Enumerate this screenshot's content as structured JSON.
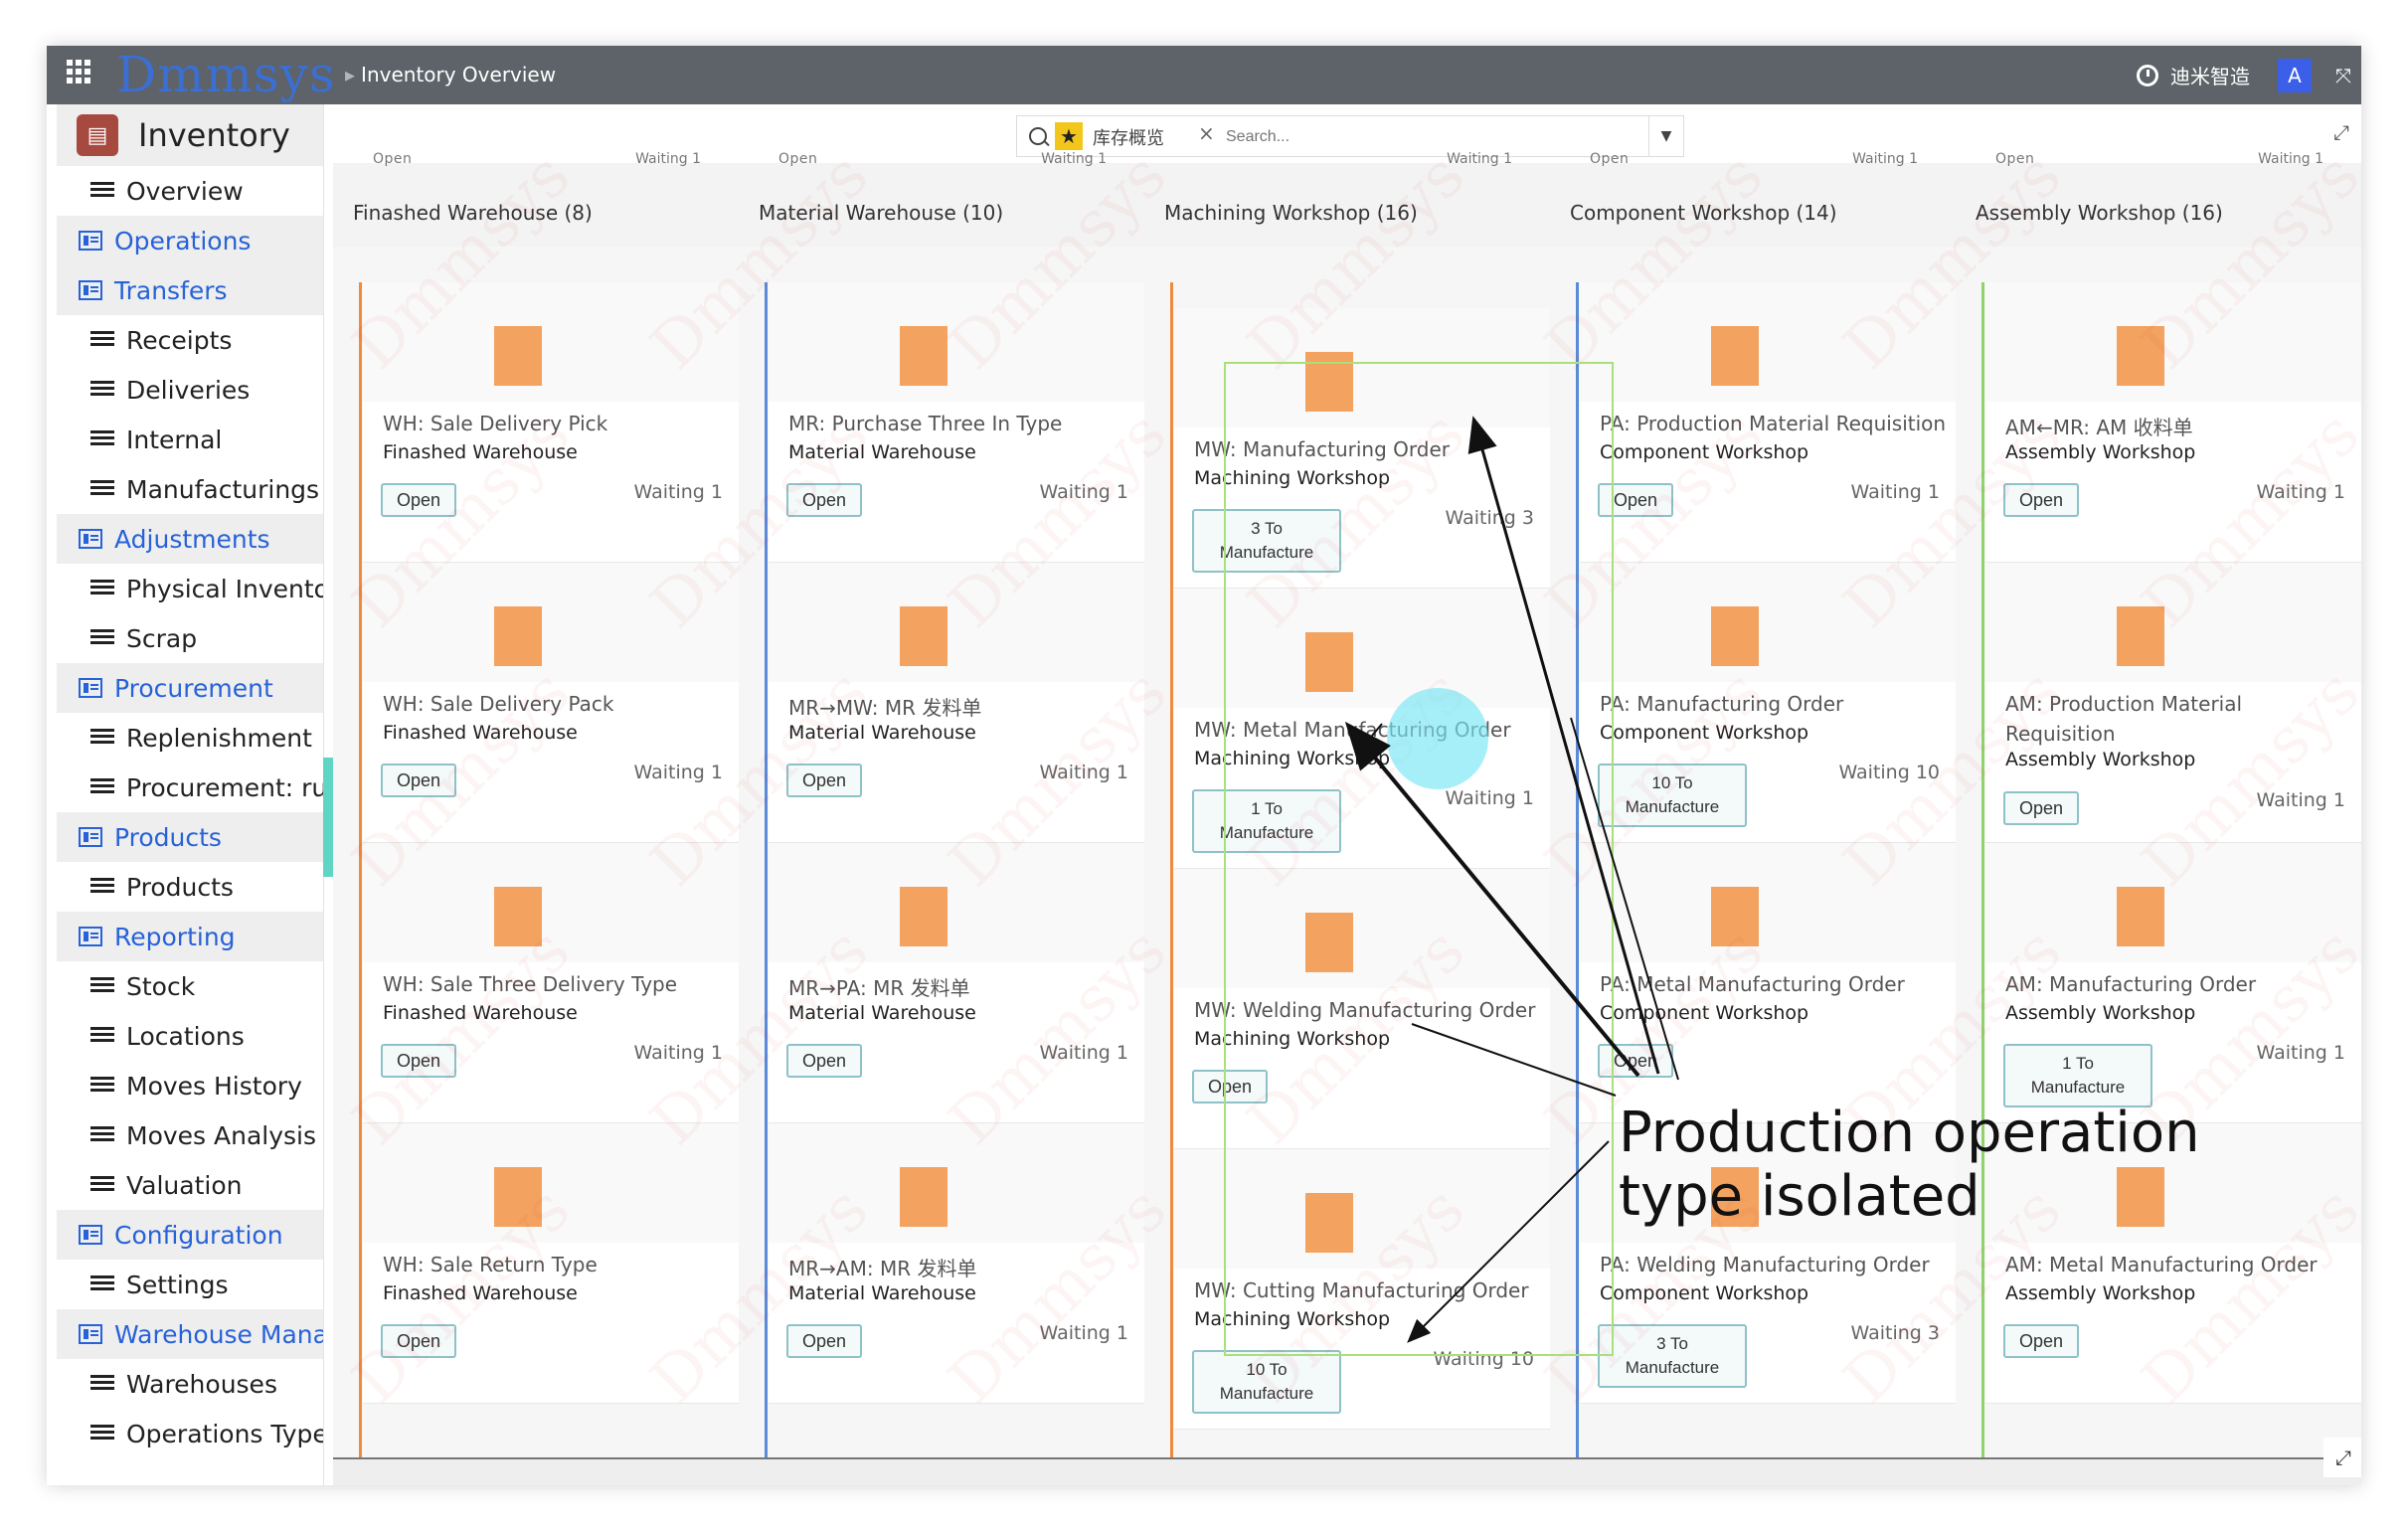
{
  "app": {
    "logo": "Dmmsys",
    "breadcrumb": "Inventory Overview",
    "company": "迪米智造",
    "avatar": "A"
  },
  "sidebar": {
    "app_name": "Inventory",
    "items": [
      {
        "label": "Overview",
        "type": "leaf"
      },
      {
        "label": "Operations",
        "type": "section"
      },
      {
        "label": "Transfers",
        "type": "section"
      },
      {
        "label": "Receipts",
        "type": "leaf"
      },
      {
        "label": "Deliveries",
        "type": "leaf"
      },
      {
        "label": "Internal",
        "type": "leaf"
      },
      {
        "label": "Manufacturings",
        "type": "leaf"
      },
      {
        "label": "Adjustments",
        "type": "section"
      },
      {
        "label": "Physical Inventory",
        "type": "leaf"
      },
      {
        "label": "Scrap",
        "type": "leaf"
      },
      {
        "label": "Procurement",
        "type": "section"
      },
      {
        "label": "Replenishment",
        "type": "leaf"
      },
      {
        "label": "Procurement: run",
        "type": "leaf"
      },
      {
        "label": "Products",
        "type": "section"
      },
      {
        "label": "Products",
        "type": "leaf"
      },
      {
        "label": "Reporting",
        "type": "section"
      },
      {
        "label": "Stock",
        "type": "leaf"
      },
      {
        "label": "Locations",
        "type": "leaf"
      },
      {
        "label": "Moves History",
        "type": "leaf"
      },
      {
        "label": "Moves Analysis",
        "type": "leaf"
      },
      {
        "label": "Valuation",
        "type": "leaf"
      },
      {
        "label": "Configuration",
        "type": "section"
      },
      {
        "label": "Settings",
        "type": "leaf"
      },
      {
        "label": "Warehouse Manag",
        "type": "section"
      },
      {
        "label": "Warehouses",
        "type": "leaf"
      },
      {
        "label": "Operations Types",
        "type": "leaf"
      }
    ]
  },
  "search": {
    "facet": "库存概览",
    "placeholder": "Search..."
  },
  "columns": [
    {
      "title": "Finashed Warehouse (8)",
      "color": "#f08a3c",
      "peek": [
        "Open",
        "Waiting 1"
      ],
      "cards": [
        {
          "title": "WH: Sale Delivery Pick",
          "sub": "Finashed Warehouse",
          "button": "Open",
          "waiting": "Waiting 1"
        },
        {
          "title": "WH: Sale Delivery Pack",
          "sub": "Finashed Warehouse",
          "button": "Open",
          "waiting": "Waiting 1"
        },
        {
          "title": "WH: Sale Three Delivery Type",
          "sub": "Finashed Warehouse",
          "button": "Open",
          "waiting": "Waiting 1"
        },
        {
          "title": "WH: Sale Return Type",
          "sub": "Finashed Warehouse",
          "button": "Open",
          "waiting": ""
        }
      ]
    },
    {
      "title": "Material Warehouse (10)",
      "color": "#5a8ad8",
      "peek": [
        "Open",
        "Waiting 1"
      ],
      "cards": [
        {
          "title": "MR: Purchase Three In Type",
          "sub": "Material Warehouse",
          "button": "Open",
          "waiting": "Waiting 1"
        },
        {
          "title": "MR→MW: MR 发料单",
          "sub": "Material Warehouse",
          "button": "Open",
          "waiting": "Waiting 1"
        },
        {
          "title": "MR→PA: MR 发料单",
          "sub": "Material Warehouse",
          "button": "Open",
          "waiting": "Waiting 1"
        },
        {
          "title": "MR→AM: MR 发料单",
          "sub": "Material Warehouse",
          "button": "Open",
          "waiting": "Waiting 1"
        }
      ]
    },
    {
      "title": "Machining Workshop (16)",
      "color": "#f08a3c",
      "peek": [
        "",
        "Waiting 1"
      ],
      "cards": [
        {
          "title": "MW: Manufacturing Order",
          "sub": "Machining Workshop",
          "button": "3 To|Manufacture",
          "waiting": "Waiting 3"
        },
        {
          "title": "MW: Metal Manufacturing Order",
          "sub": "Machining Workshop",
          "button": "1 To|Manufacture",
          "waiting": "Waiting 1"
        },
        {
          "title": "MW: Welding Manufacturing Order",
          "sub": "Machining Workshop",
          "button": "Open",
          "waiting": ""
        },
        {
          "title": "MW: Cutting Manufacturing Order",
          "sub": "Machining Workshop",
          "button": "10 To|Manufacture",
          "waiting": "Waiting 10"
        }
      ]
    },
    {
      "title": "Component Workshop (14)",
      "color": "#5a8ad8",
      "peek": [
        "Open",
        "Waiting 1"
      ],
      "cards": [
        {
          "title": "PA: Production Material Requisition",
          "sub": "Component Workshop",
          "button": "Open",
          "waiting": "Waiting 1"
        },
        {
          "title": "PA: Manufacturing Order",
          "sub": "Component Workshop",
          "button": "10 To|Manufacture",
          "waiting": "Waiting 10"
        },
        {
          "title": "PA: Metal Manufacturing Order",
          "sub": "Component Workshop",
          "button": "Open",
          "waiting": ""
        },
        {
          "title": "PA: Welding Manufacturing Order",
          "sub": "Component Workshop",
          "button": "3 To|Manufacture",
          "waiting": "Waiting 3"
        }
      ]
    },
    {
      "title": "Assembly Workshop (16)",
      "color": "#8fd46b",
      "peek": [
        "Open",
        "Waiting 1"
      ],
      "cards": [
        {
          "title": "AM←MR: AM 收料单",
          "sub": "Assembly Workshop",
          "button": "Open",
          "waiting": "Waiting 1"
        },
        {
          "title": "AM: Production Material|Requisition",
          "sub": "Assembly Workshop",
          "button": "Open",
          "waiting": "Waiting 1"
        },
        {
          "title": "AM: Manufacturing Order",
          "sub": "Assembly Workshop",
          "button": "1 To|Manufacture",
          "waiting": "Waiting 1"
        },
        {
          "title": "AM: Metal Manufacturing Order",
          "sub": "Assembly Workshop",
          "button": "Open",
          "waiting": ""
        }
      ]
    }
  ],
  "annotation": {
    "line1": "Production operation",
    "line2": "type isolated"
  },
  "colors": {
    "topbar": "#5d6368",
    "accent": "#2762d8",
    "block": "#f3a25f",
    "highlight": "#a8e07a",
    "button_border": "#8fc1c8"
  },
  "icons": [
    "apps-grid-icon",
    "clock-icon",
    "fullscreen-icon",
    "search-icon",
    "star-icon",
    "close-icon",
    "chevron-down-icon",
    "expand-icon"
  ]
}
